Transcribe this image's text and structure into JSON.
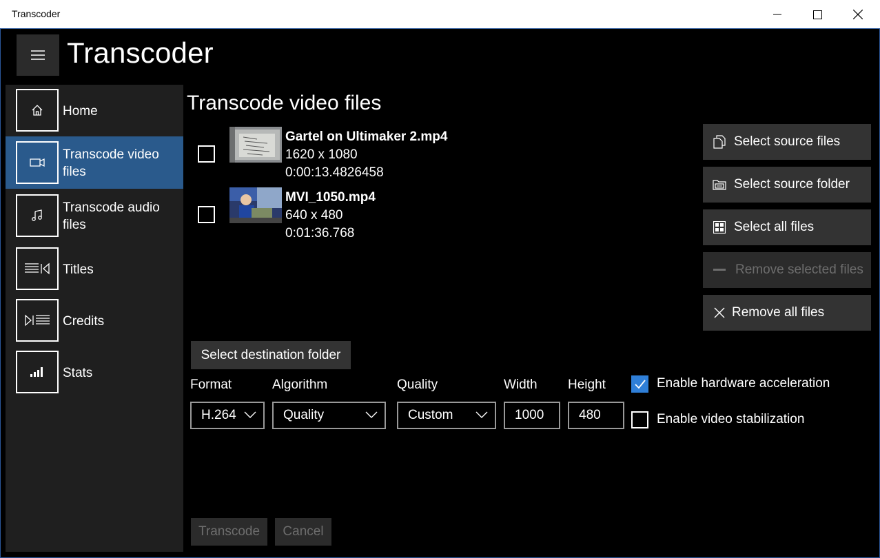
{
  "window": {
    "title": "Transcoder"
  },
  "app": {
    "title": "Transcoder"
  },
  "nav": {
    "items": [
      {
        "label": "Home"
      },
      {
        "label": "Transcode video files"
      },
      {
        "label": "Transcode audio files"
      },
      {
        "label": "Titles"
      },
      {
        "label": "Credits"
      },
      {
        "label": "Stats"
      }
    ],
    "active_index": 1
  },
  "page": {
    "heading": "Transcode video files"
  },
  "files": [
    {
      "name": "Gartel on Ultimaker 2.mp4",
      "resolution": "1620 x 1080",
      "duration": "0:00:13.4826458",
      "checked": false
    },
    {
      "name": "MVI_1050.mp4",
      "resolution": "640 x 480",
      "duration": "0:01:36.768",
      "checked": false
    }
  ],
  "actions": {
    "select_source_files": "Select source files",
    "select_source_folder": "Select source folder",
    "select_all_files": "Select all files",
    "remove_selected_files": "Remove selected files",
    "remove_all_files": "Remove all files",
    "select_destination_folder": "Select destination folder",
    "transcode": "Transcode",
    "cancel": "Cancel"
  },
  "settings": {
    "format_label": "Format",
    "format_value": "H.264",
    "algorithm_label": "Algorithm",
    "algorithm_value": "Quality",
    "quality_label": "Quality",
    "quality_value": "Custom",
    "width_label": "Width",
    "width_value": "1000",
    "height_label": "Height",
    "height_value": "480",
    "hw_accel_label": "Enable hardware acceleration",
    "hw_accel_checked": true,
    "stabilization_label": "Enable video stabilization",
    "stabilization_checked": false
  },
  "colors": {
    "accent": "#2f7fd8",
    "nav_active": "#2a5a8c",
    "button": "#333333"
  },
  "icons": [
    "hamburger-icon",
    "home-icon",
    "video-camera-icon",
    "music-note-icon",
    "titles-icon",
    "credits-icon",
    "stats-icon",
    "copy-icon",
    "folder-icon",
    "grid-icon",
    "minus-icon",
    "close-icon",
    "chevron-down-icon",
    "checkmark-icon"
  ]
}
